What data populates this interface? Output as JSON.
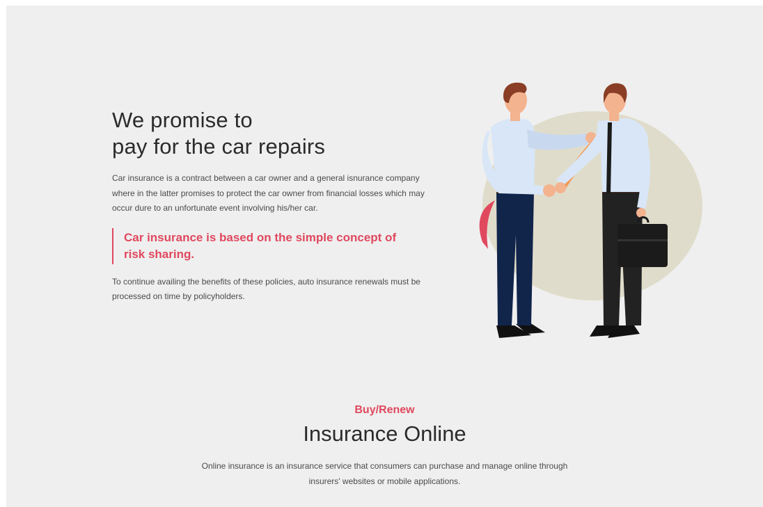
{
  "hero": {
    "title_line1": "We promise to",
    "title_line2": "pay for the car repairs",
    "paragraph": "Car insurance is a contract between a car owner and a general isnurance company where in the latter promises to protect the car owner from financial losses which may occur dure to an unfortunate event involving his/her car.",
    "quote": "Car insurance is based on the simple concept of risk sharing.",
    "paragraph2": "To continue availing the benefits of these policies, auto insurance renewals must be processed on time by policyholders."
  },
  "illustration": {
    "icon": "handshake-businessmen-illustration",
    "colors": {
      "blob": "#e0dccb",
      "accent": "#e0485e",
      "shirt": "#d8e6f7",
      "navy_pants": "#11244a",
      "black_pants": "#222222",
      "hair": "#8a3e26",
      "skin": "#f3b38f",
      "tie": "#f29a5a"
    }
  },
  "online": {
    "eyebrow": "Buy/Renew",
    "title": "Insurance Online",
    "paragraph": "Online insurance is an insurance service that consumers can purchase and manage online through insurers' websites or mobile applications."
  }
}
